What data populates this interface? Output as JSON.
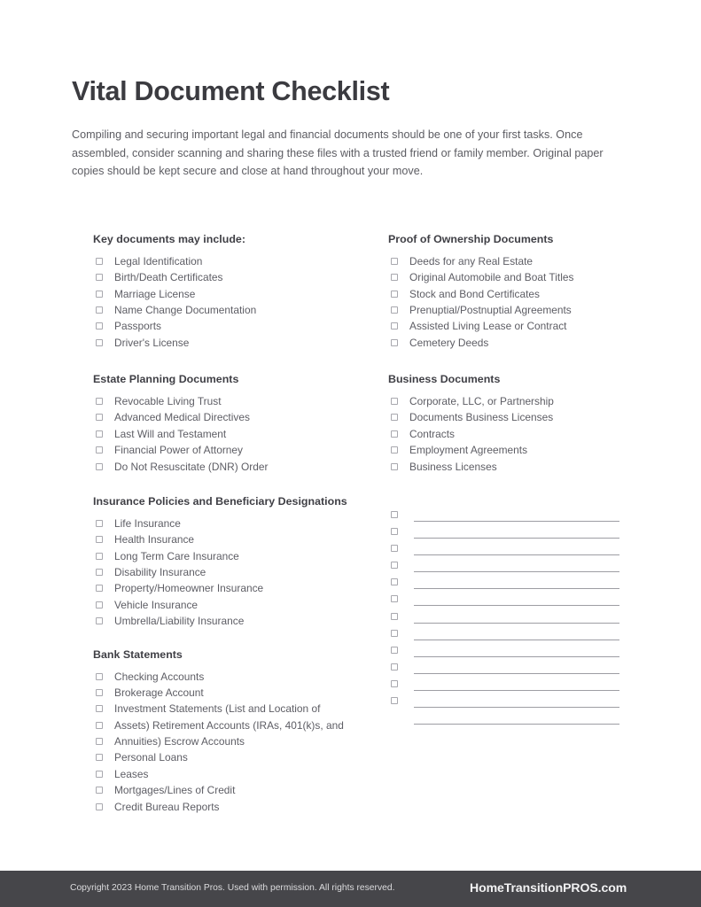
{
  "document": {
    "title": "Vital Document Checklist",
    "intro": "Compiling and securing important legal and financial documents should be one of your first tasks. Once assembled, consider scanning and sharing these files with a trusted friend or family member. Original paper copies should be kept secure and close at hand throughout your move."
  },
  "left_column": {
    "section1": {
      "title": "Key documents may include:",
      "items": [
        "Legal Identification",
        "Birth/Death Certificates",
        "Marriage License",
        "Name Change Documentation",
        "Passports",
        "Driver's License"
      ]
    },
    "section2": {
      "title": "Estate Planning Documents",
      "items": [
        "Revocable Living Trust",
        "Advanced Medical Directives",
        "Last Will and Testament",
        "Financial Power of Attorney",
        "Do Not Resuscitate (DNR) Order"
      ]
    },
    "section3": {
      "title": "Insurance Policies and Beneficiary Designations",
      "items": [
        "Life Insurance",
        "Health Insurance",
        "Long Term Care Insurance",
        "Disability Insurance",
        "Property/Homeowner Insurance",
        "Vehicle Insurance",
        "Umbrella/Liability Insurance"
      ]
    },
    "section4": {
      "title": "Bank Statements",
      "items": [
        "Checking Accounts",
        "Brokerage Account",
        "Investment Statements (List and Location of",
        "Assets) Retirement Accounts (IRAs, 401(k)s, and",
        "Annuities) Escrow Accounts",
        "Personal Loans",
        "Leases",
        "Mortgages/Lines of Credit",
        "Credit Bureau Reports"
      ]
    }
  },
  "right_column": {
    "section1": {
      "title": "Proof of Ownership Documents",
      "items": [
        "Deeds for any Real Estate",
        "Original Automobile and Boat Titles",
        "Stock and Bond Certificates",
        "Prenuptial/Postnuptial Agreements",
        "Assisted Living Lease or Contract",
        "Cemetery Deeds"
      ]
    },
    "section2": {
      "title": "Business Documents",
      "items": [
        "Corporate, LLC, or Partnership",
        "Documents Business Licenses",
        "Contracts",
        "Employment Agreements",
        "Business Licenses"
      ]
    },
    "blank_rows_count": 12
  },
  "footer": {
    "copyright": "Copyright 2023 Home Transition Pros. Used with  permission. All rights reserved.",
    "brand": "HomeTransitionPROS.com",
    "background_color": "#46464a"
  }
}
